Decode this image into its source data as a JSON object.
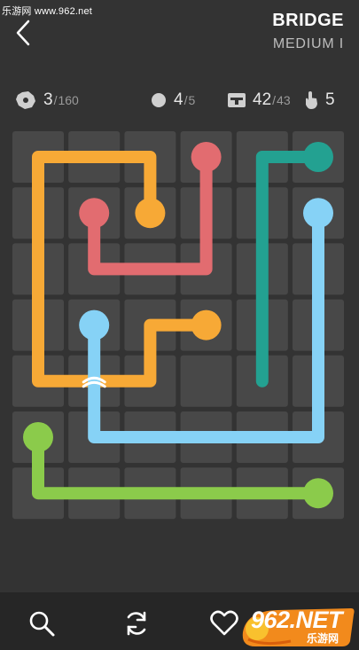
{
  "watermark": {
    "top_text": "乐游网 www.962.net",
    "logo_text": "962.NET",
    "logo_sub": "乐游网"
  },
  "header": {
    "title": "BRIDGE",
    "subtitle": "MEDIUM I"
  },
  "stats": {
    "levels": {
      "icon": "gear-icon",
      "value": "3",
      "total": "160"
    },
    "flows": {
      "icon": "dot-icon",
      "value": "4",
      "total": "5"
    },
    "pipe": {
      "icon": "pipe-icon",
      "value": "42",
      "total": "43"
    },
    "moves": {
      "icon": "hand-icon",
      "value": "5"
    }
  },
  "colors": {
    "background": "#333333",
    "cell": "#484848",
    "orange": "#f7a936",
    "red": "#e26c70",
    "teal": "#23a191",
    "blue": "#86d2f6",
    "green": "#8bcb4b",
    "bottom_bar": "#262626"
  },
  "board": {
    "cols": 6,
    "rows": 7,
    "bridge_cell": {
      "col": 1,
      "row": 4
    },
    "flows": [
      {
        "name": "orange",
        "color": "#f7a936",
        "points": [
          [
            2,
            1
          ],
          [
            2,
            0
          ],
          [
            0,
            0
          ],
          [
            0,
            4
          ],
          [
            2,
            4
          ],
          [
            2,
            3
          ],
          [
            3,
            3
          ]
        ]
      },
      {
        "name": "red",
        "color": "#e26c70",
        "points": [
          [
            3,
            0
          ],
          [
            3,
            2
          ],
          [
            1,
            2
          ],
          [
            1,
            1
          ]
        ]
      },
      {
        "name": "teal",
        "color": "#23a191",
        "points": [
          [
            5,
            0
          ],
          [
            4,
            0
          ],
          [
            4,
            4
          ]
        ]
      },
      {
        "name": "blue",
        "color": "#86d2f6",
        "points": [
          [
            1,
            3
          ],
          [
            1,
            5
          ],
          [
            5,
            5
          ],
          [
            5,
            1
          ]
        ]
      },
      {
        "name": "green",
        "color": "#8bcb4b",
        "points": [
          [
            0,
            5
          ],
          [
            0,
            6
          ],
          [
            5,
            6
          ]
        ]
      }
    ],
    "endpoints": [
      {
        "color": "#f7a936",
        "col": 2,
        "row": 1
      },
      {
        "color": "#f7a936",
        "col": 3,
        "row": 3
      },
      {
        "color": "#e26c70",
        "col": 3,
        "row": 0
      },
      {
        "color": "#e26c70",
        "col": 1,
        "row": 1
      },
      {
        "color": "#23a191",
        "col": 5,
        "row": 0
      },
      {
        "color": "#86d2f6",
        "col": 1,
        "row": 3
      },
      {
        "color": "#86d2f6",
        "col": 5,
        "row": 1
      },
      {
        "color": "#8bcb4b",
        "col": 0,
        "row": 5
      },
      {
        "color": "#8bcb4b",
        "col": 5,
        "row": 6
      }
    ]
  },
  "toolbar": {
    "hint_icon": "search-icon",
    "reset_icon": "refresh-icon",
    "like_icon": "heart-icon"
  }
}
